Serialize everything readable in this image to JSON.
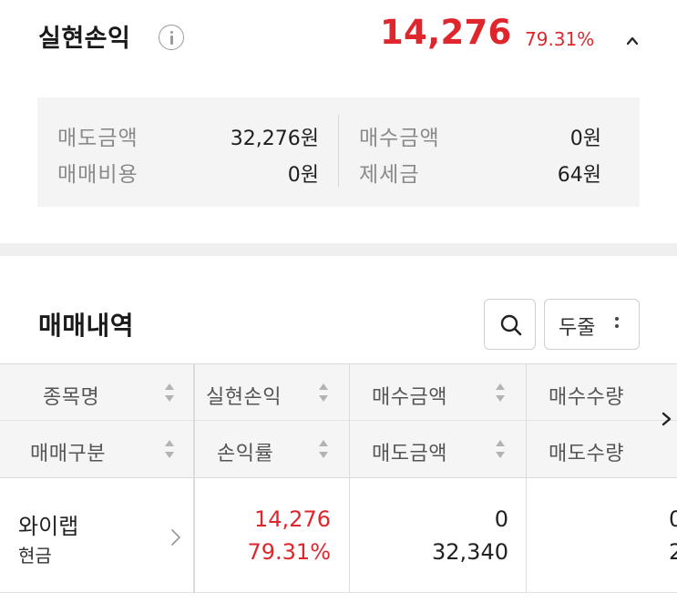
{
  "realized": {
    "title": "실현손익",
    "value": "14,276",
    "rate": "79.31%",
    "accent_color": "#e0262d"
  },
  "summary": {
    "sell_amount_label": "매도금액",
    "sell_amount_value": "32,276원",
    "trade_cost_label": "매매비용",
    "trade_cost_value": "0원",
    "buy_amount_label": "매수금액",
    "buy_amount_value": "0원",
    "tax_label": "제세금",
    "tax_value": "64원"
  },
  "history": {
    "title": "매매내역",
    "filter_label": "두줄"
  },
  "table": {
    "headers_row1": [
      "종목명",
      "실현손익",
      "매수금액",
      "매수수량"
    ],
    "headers_row2": [
      "매매구분",
      "손익률",
      "매도금액",
      "매도수량"
    ],
    "rows": [
      {
        "name": "와이랩",
        "type": "현금",
        "realized_pl": "14,276",
        "pl_rate": "79.31%",
        "buy_amount": "0",
        "sell_amount": "32,340",
        "buy_qty_partial": "0",
        "sell_qty_partial": "2"
      }
    ]
  },
  "icons": {
    "info": "info-icon",
    "collapse": "chevron-up-icon",
    "search": "search-icon",
    "more": "kebab-icon",
    "sort": "sort-icon",
    "row_detail": "chevron-right-icon",
    "scroll": "chevron-right-icon"
  }
}
